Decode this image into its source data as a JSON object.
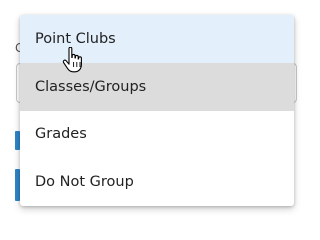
{
  "menu": {
    "options": [
      {
        "label": "Point Clubs",
        "state": "hovered"
      },
      {
        "label": "Classes/Groups",
        "state": "selected"
      },
      {
        "label": "Grades",
        "state": "normal"
      },
      {
        "label": "Do Not Group",
        "state": "normal"
      }
    ]
  },
  "background": {
    "label_fragment": "G"
  },
  "colors": {
    "hover": "#e3f0fb",
    "selected": "#dcdcdc",
    "accent": "#2d85c8",
    "text": "#222222"
  },
  "cursor": {
    "icon": "hand-pointer-icon"
  }
}
